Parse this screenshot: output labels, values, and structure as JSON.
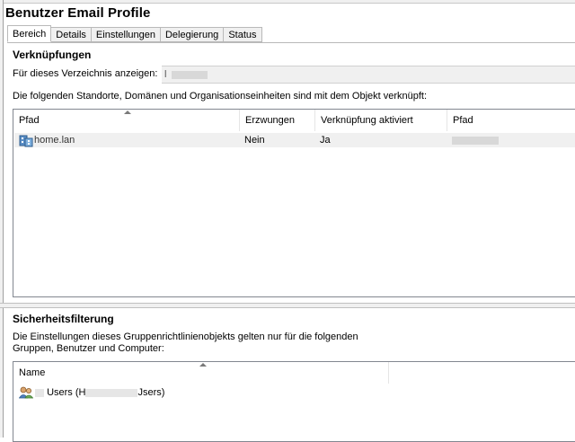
{
  "window": {
    "title": "Benutzer Email Profile"
  },
  "tabs": [
    {
      "label": "Bereich",
      "active": true
    },
    {
      "label": "Details",
      "active": false
    },
    {
      "label": "Einstellungen",
      "active": false
    },
    {
      "label": "Delegierung",
      "active": false
    },
    {
      "label": "Status",
      "active": false
    }
  ],
  "links": {
    "section_title": "Verknüpfungen",
    "directory_label": "Für dieses Verzeichnis anzeigen:",
    "directory_value": "l",
    "description": "Die folgenden Standorte, Domänen und Organisationseinheiten sind mit dem Objekt verknüpft:",
    "columns": [
      "Pfad",
      "Erzwungen",
      "Verknüpfung aktiviert",
      "Pfad"
    ],
    "rows": [
      {
        "icon": "domain-icon",
        "path": "home.lan",
        "enforced": "Nein",
        "link_enabled": "Ja",
        "path2": ""
      }
    ]
  },
  "security": {
    "section_title": "Sicherheitsfilterung",
    "description_line1": "Die Einstellungen dieses Gruppenrichtlinienobjekts gelten nur für die folgenden",
    "description_line2": "Gruppen, Benutzer und Computer:",
    "columns": [
      "Name"
    ],
    "rows": [
      {
        "icon": "users-group-icon",
        "name": "Users (H",
        "name_end": "Jsers)"
      }
    ]
  },
  "colors": {
    "selection_row": "#f0f0f0",
    "border": "#828790",
    "window_bg": "#ffffff"
  }
}
